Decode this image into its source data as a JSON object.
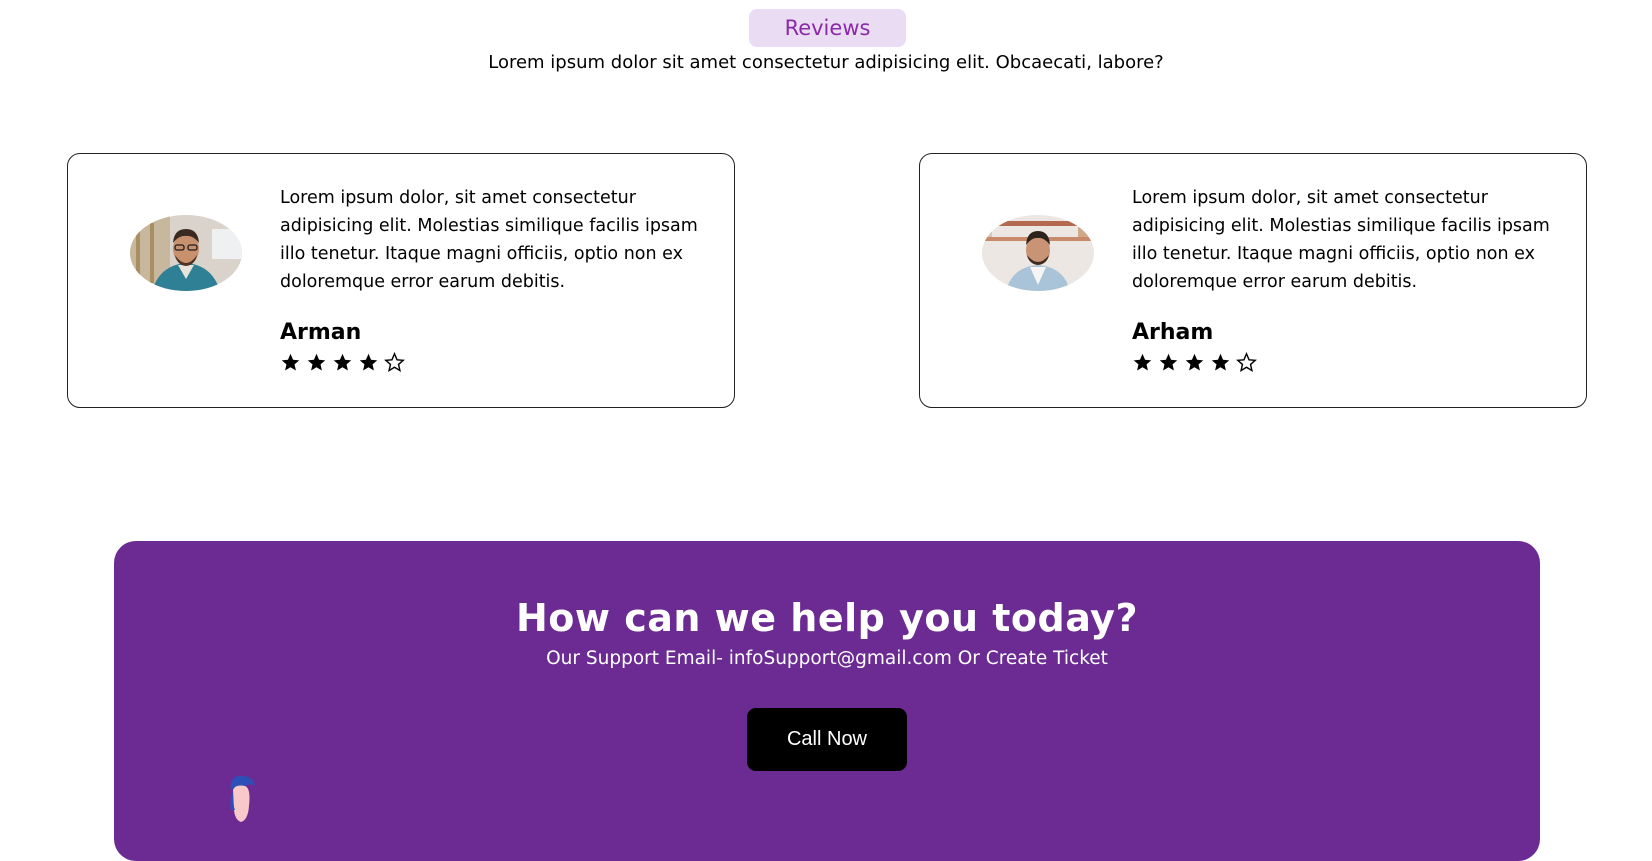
{
  "reviews_section": {
    "pill_label": "Reviews",
    "subtitle": "Lorem ipsum dolor sit amet consectetur adipisicing elit. Obcaecati, labore?"
  },
  "reviews": [
    {
      "text": "Lorem ipsum dolor, sit amet consectetur adipisicing elit. Molestias similique facilis ipsam illo tenetur. Itaque magni officiis, optio non ex doloremque error earum debitis.",
      "name": "Arman",
      "rating": 4,
      "max_rating": 5,
      "avatar_icon": "person-photo-icon"
    },
    {
      "text": "Lorem ipsum dolor, sit amet consectetur adipisicing elit. Molestias similique facilis ipsam illo tenetur. Itaque magni officiis, optio non ex doloremque error earum debitis.",
      "name": "Arham",
      "rating": 4,
      "max_rating": 5,
      "avatar_icon": "person-photo-icon"
    }
  ],
  "cta": {
    "title": "How can we help you today?",
    "subtitle": "Our Support Email- infoSupport@gmail.com Or Create Ticket",
    "button_label": "Call Now",
    "background_color": "#6b2b92"
  },
  "colors": {
    "pill_bg": "#eadcf3",
    "pill_text": "#8a2aa8",
    "button_bg": "#000000"
  }
}
